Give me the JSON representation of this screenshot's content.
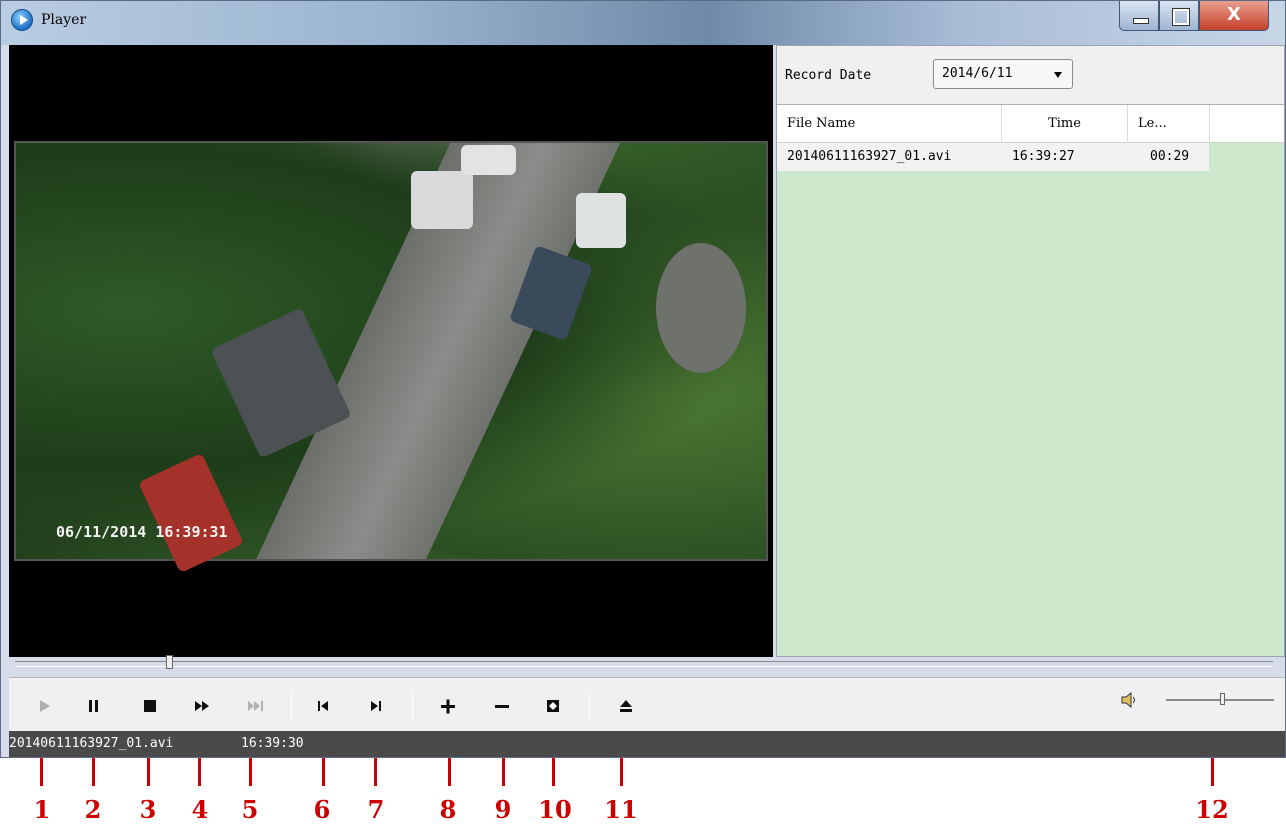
{
  "window": {
    "title": "Player",
    "minimize_label": "",
    "maximize_label": "",
    "close_label": "X"
  },
  "video": {
    "osd_timestamp": "06/11/2014 16:39:31"
  },
  "panel": {
    "record_date_label": "Record Date",
    "record_date_value": "2014/6/11",
    "columns": [
      "File Name",
      "Time",
      "Le..."
    ],
    "rows": [
      {
        "file_name": "20140611163927_01.avi",
        "time": "16:39:27",
        "length": "00:29"
      }
    ],
    "list_bg": "#cde8cc"
  },
  "playback": {
    "progress_fraction": 0.12,
    "volume_fraction": 0.5,
    "buttons": [
      {
        "name": "play",
        "icon": "play-icon",
        "enabled": false
      },
      {
        "name": "pause",
        "icon": "pause-icon",
        "enabled": true
      },
      {
        "name": "stop",
        "icon": "stop-icon",
        "enabled": true
      },
      {
        "name": "fast-forward",
        "icon": "fast-forward-icon",
        "enabled": true
      },
      {
        "name": "step-forward",
        "icon": "step-forward-icon",
        "enabled": false
      },
      {
        "name": "previous",
        "icon": "previous-icon",
        "enabled": true
      },
      {
        "name": "next",
        "icon": "next-icon",
        "enabled": true
      },
      {
        "name": "zoom-in",
        "icon": "plus-icon",
        "enabled": true
      },
      {
        "name": "zoom-out",
        "icon": "minus-icon",
        "enabled": true
      },
      {
        "name": "fullscreen",
        "icon": "fullscreen-icon",
        "enabled": true
      },
      {
        "name": "eject",
        "icon": "eject-icon",
        "enabled": true
      }
    ]
  },
  "status": {
    "current_file": "20140611163927_01.avi",
    "current_time": "16:39:30"
  },
  "callouts": [
    "1",
    "2",
    "3",
    "4",
    "5",
    "6",
    "7",
    "8",
    "9",
    "10",
    "11",
    "12"
  ],
  "colors": {
    "callout": "#cc0000",
    "statusbar": "#4a4a4a"
  }
}
